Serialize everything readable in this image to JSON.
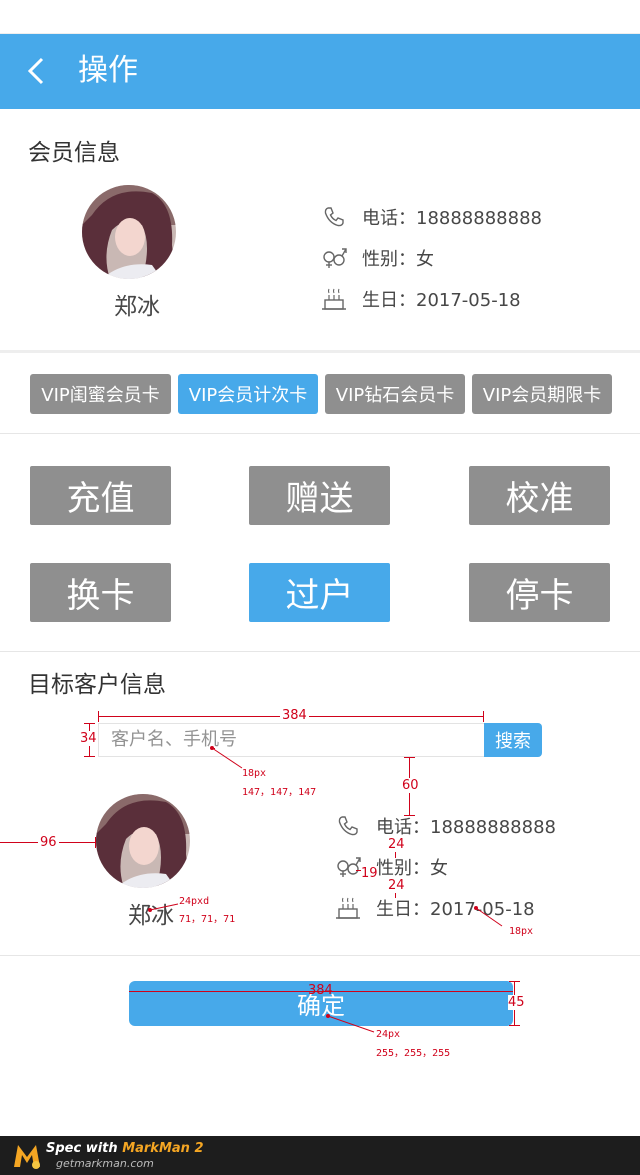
{
  "header": {
    "title": "操作"
  },
  "member": {
    "section_title": "会员信息",
    "name": "郑冰",
    "phone": "电话：18888888888",
    "gender": "性别：女",
    "birthday": "生日：2017-05-18"
  },
  "cards": [
    {
      "label": "VIP闺蜜会员卡",
      "active": false
    },
    {
      "label": "VIP会员计次卡",
      "active": true
    },
    {
      "label": "VIP钻石会员卡",
      "active": false
    },
    {
      "label": "VIP会员期限卡",
      "active": false
    }
  ],
  "operations": {
    "recharge": "充值",
    "gift": "赠送",
    "calibrate": "校准",
    "change_card": "换卡",
    "transfer": "过户",
    "stop_card": "停卡"
  },
  "target": {
    "section_title": "目标客户信息",
    "search_placeholder": "客户名、手机号",
    "search_button": "搜索",
    "name": "郑冰",
    "phone": "电话：18888888888",
    "gender": "性别：女",
    "birthday": "生日：2017-05-18"
  },
  "confirm_label": "确定",
  "annotations": {
    "w384_top": "384",
    "h34": "34",
    "font18_grey": "18px",
    "rgb147": "147，147，147",
    "v60": "60",
    "h96": "96",
    "v24a": "24",
    "h19": "19",
    "v24b": "24",
    "font24pxd": "24pxd",
    "rgb71": "71，71，71",
    "font18_b": "18px",
    "w384_btn": "384",
    "h45": "45",
    "font24_btn": "24px",
    "rgb255": "255，255，255"
  },
  "footer": {
    "brand_prefix": "Spec with ",
    "brand_name": "MarkMan 2",
    "url": "getmarkman.com"
  },
  "colors": {
    "primary": "#47a9ea",
    "gray_button": "#8f8f8f",
    "annotation": "#d0021b"
  }
}
